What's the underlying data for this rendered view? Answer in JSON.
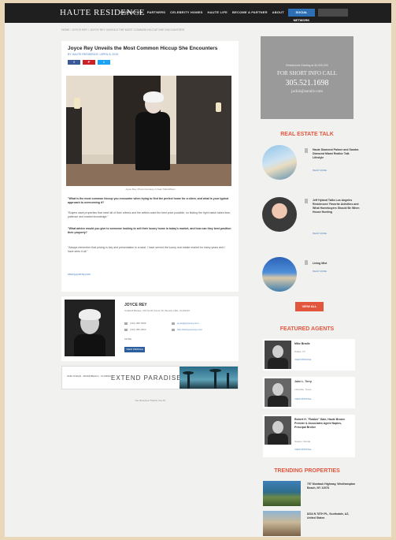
{
  "header": {
    "logo": "HAUTE RESIDENCE",
    "nav": [
      "PROPERTIES",
      "PARTNERS",
      "CELEBRITY HOMES",
      "HAUTE LIFE",
      "BECOME A PARTNER",
      "ABOUT",
      "CONTACT"
    ],
    "cta": "SOCIAL NETWORK"
  },
  "breadcrumb": "HOME / JOYCE REY / JOYCE REY UNVEILS THE MOST COMMON HICCUP SHE ENCOUNTERS",
  "article": {
    "title": "Joyce Rey Unveils the Most Common Hiccup She Encounters",
    "byline": "BY HAUTE RESIDENCE / APRIL 8, 2019",
    "share": [
      {
        "label": "f",
        "color": "#3b5998"
      },
      {
        "label": "P",
        "color": "#cb2027"
      },
      {
        "label": "t",
        "color": "#1da1f2"
      }
    ],
    "caption": "Joyce Rey, Photo Courtesy of Juan Tallo/Wilson",
    "paragraphs": [
      {
        "text": "\"What is the most common hiccup you encounter when trying to find the perfect home for a client, and what is your typical approach to overcoming it?",
        "bold": true
      },
      {
        "text": "\"Buyers want properties that meet all of their criteria and the sellers want the best price possible, so finding the right match takes time, patience and market knowledge.\"",
        "bold": false
      },
      {
        "text": "\"What advice would you give to someone looking to sell their luxury home in today's market, and how can they best position their property?",
        "bold": true
      },
      {
        "text": "\"Always remember that pricing is key and presentation is crucial. I have served the luxury real estate market for many years and I have seen it all.\"",
        "bold": false
      }
    ],
    "link": "www.joycerey.com"
  },
  "agent": {
    "name": "JOYCE REY",
    "address": "Coldwell Banker, 301 North Canon Dr, Beverly Hills, CA 90210",
    "phone": "(310) 285-5388",
    "fax": "(310) 285-0660",
    "email": "joyce@joycerey.com",
    "website": "http://www.joycerey.com",
    "more": "MORE",
    "button": "VIEW PROFILE"
  },
  "banner": {
    "left": "ONE OCEAN · MIAMI BEACH · FLORIDA",
    "text": "EXTEND PARADISE"
  },
  "footnote": "You Received Thanks You All",
  "ad": {
    "line1": "Residences Starting at $1,000,000",
    "line2": "FOR SHORT INFO CALL",
    "line3": "305.521.1698",
    "line4": "jackie@auraliv.com"
  },
  "real_estate_talk": {
    "title": "REAL ESTATE TALK",
    "items": [
      {
        "title": "Haute Diamond Palmer and Sandra Diamond Miami Realtor Talk Lifestyle",
        "link": "READ MORE"
      },
      {
        "title": "Jeff Hyland Talks Los Angeles Residences' Favorite Activities and What Homebuyers Should Be When House Hunting",
        "link": "READ MORE"
      },
      {
        "title": "Living Mist",
        "link": "READ MORE"
      }
    ],
    "view_all": "VIEW ALL"
  },
  "featured_agents": {
    "title": "FEATURED AGENTS",
    "items": [
      {
        "name": "Mike Bradle",
        "sub": "Dallas, TX",
        "link": "VIEW PROFILE"
      },
      {
        "name": "John L. Terry",
        "sub": "Lakeside, Texas",
        "link": "VIEW PROFILE"
      },
      {
        "name": "Robert H. \"Robbie\" Dale, Haute Brown Premier & Associates Agent Naples, Principal Broker",
        "sub": "Naples, Florida",
        "link": "VIEW PROFILE"
      }
    ]
  },
  "trending": {
    "title": "TRENDING PROPERTIES",
    "items": [
      {
        "title": "757 Montauk Highway, Westhampton Beach, NY 11978"
      },
      {
        "title": "8234 N 78TH PL, Scottsdale, AZ, United States"
      }
    ]
  }
}
